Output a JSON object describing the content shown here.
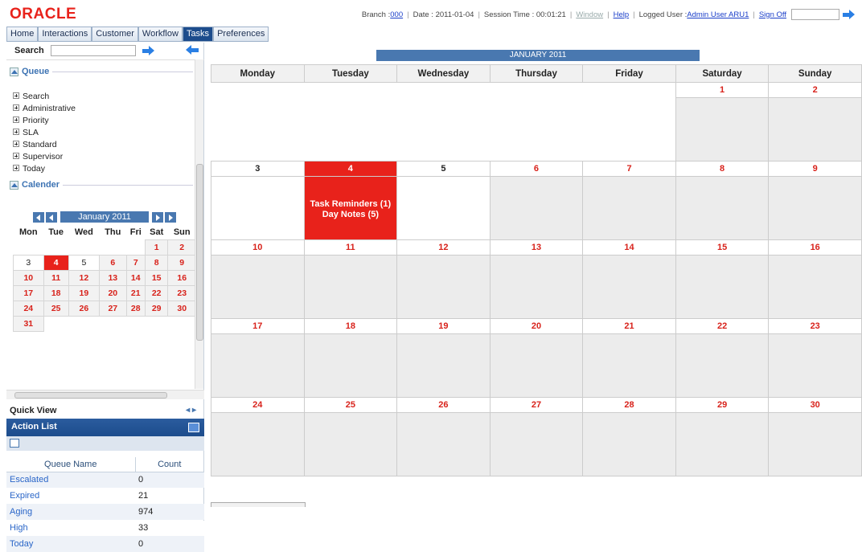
{
  "header": {
    "logo": "ORACLE",
    "branch_label": "Branch : ",
    "branch": "000",
    "date": "Date : 2011-01-04",
    "session": "Session Time : 00:01:21",
    "window": "Window",
    "help": "Help",
    "user_label": "Logged User : ",
    "user": "Admin User ARU1",
    "signoff": "Sign Off"
  },
  "nav": {
    "tabs": [
      "Home",
      "Interactions",
      "Customer",
      "Workflow",
      "Tasks",
      "Preferences"
    ],
    "active": "Tasks"
  },
  "sidebar": {
    "search_label": "Search",
    "queue_title": "Queue",
    "queue_items": [
      "Search",
      "Administrative",
      "Priority",
      "SLA",
      "Standard",
      "Supervisor",
      "Today"
    ],
    "calendar_title": "Calender",
    "mini_month": "January 2011",
    "mini_days": [
      "Mon",
      "Tue",
      "Wed",
      "Thu",
      "Fri",
      "Sat",
      "Sun"
    ],
    "quick_view": "Quick View",
    "action_list_title": "Action List",
    "queue_table": {
      "headers": [
        "Queue Name",
        "Count"
      ],
      "rows": [
        {
          "name": "Escalated",
          "count": "0"
        },
        {
          "name": "Expired",
          "count": "21"
        },
        {
          "name": "Aging",
          "count": "974"
        },
        {
          "name": "High",
          "count": "33"
        },
        {
          "name": "Today",
          "count": "0"
        }
      ]
    }
  },
  "calendar": {
    "month": "JANUARY 2011",
    "days": [
      "Monday",
      "Tuesday",
      "Wednesday",
      "Thursday",
      "Friday",
      "Saturday",
      "Sunday"
    ],
    "today_line1": "Task Reminders (1)",
    "today_line2": "Day Notes (5)"
  },
  "colors": {
    "brand_red": "#e8221b",
    "nav_active": "#1c4c8c",
    "accent_blue": "#4978b0",
    "link_blue": "#1a3ec9"
  }
}
